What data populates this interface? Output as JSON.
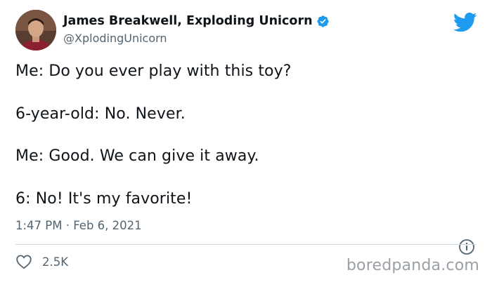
{
  "author": {
    "display_name": "James Breakwell, Exploding Unicorn",
    "handle": "@XplodingUnicorn",
    "verified": true
  },
  "tweet": {
    "lines": [
      "Me: Do you ever play with this toy?",
      "6-year-old: No. Never.",
      "Me: Good. We can give it away.",
      "6: No! It's my favorite!"
    ],
    "timestamp": "1:47 PM · Feb 6, 2021"
  },
  "engagement": {
    "likes": "2.5K"
  },
  "watermark": "boredpanda.com",
  "colors": {
    "twitter_blue": "#1d9bf0",
    "text_primary": "#0f1419",
    "text_secondary": "#536471",
    "divider": "#cfd9de"
  },
  "icons": [
    "avatar",
    "verified-badge-icon",
    "twitter-bird-icon",
    "info-icon",
    "heart-icon"
  ]
}
